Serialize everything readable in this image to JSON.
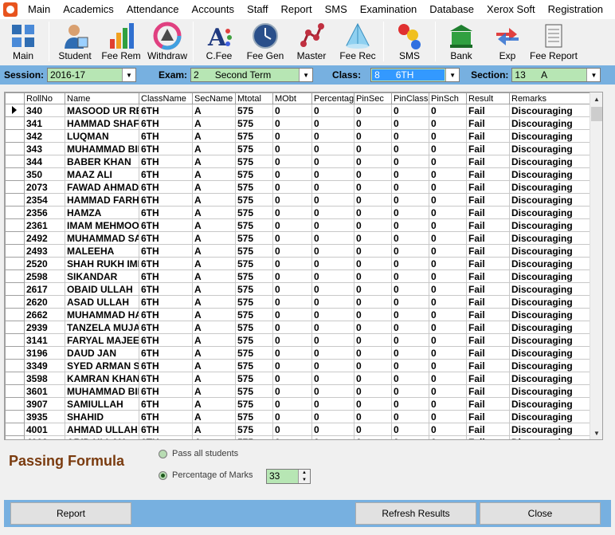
{
  "menu": [
    "Main",
    "Academics",
    "Attendance",
    "Accounts",
    "Staff",
    "Report",
    "SMS",
    "Examination",
    "Database",
    "Xerox Soft",
    "Registration"
  ],
  "toolbar": [
    {
      "label": "Main",
      "icon": "grid-icon"
    },
    {
      "label": "Student",
      "icon": "student-icon"
    },
    {
      "label": "Fee Rem",
      "icon": "bar-chart-icon"
    },
    {
      "label": "Withdraw",
      "icon": "color-wheel-icon"
    },
    {
      "label": "C.Fee",
      "icon": "font-icon"
    },
    {
      "label": "Fee Gen",
      "icon": "clock-icon"
    },
    {
      "label": "Master",
      "icon": "network-icon"
    },
    {
      "label": "Fee Rec",
      "icon": "pyramid-icon"
    },
    {
      "label": "SMS",
      "icon": "molecule-icon"
    },
    {
      "label": "Bank",
      "icon": "bank-icon"
    },
    {
      "label": "Exp",
      "icon": "arrows-icon"
    },
    {
      "label": "Fee Report",
      "icon": "scroll-icon"
    }
  ],
  "filters": {
    "session_label": "Session:",
    "session_value": "2016-17",
    "exam_label": "Exam:",
    "exam_value": "2      Second Term",
    "class_label": "Class:",
    "class_value": "8      6TH",
    "section_label": "Section:",
    "section_value": "13      A"
  },
  "columns": [
    "RollNo",
    "Name",
    "ClassName",
    "SecName",
    "Mtotal",
    "MObt",
    "Percentage",
    "PinSec",
    "PinClass",
    "PinSch",
    "Result",
    "Remarks"
  ],
  "rows": [
    [
      "340",
      "MASOOD UR REHMAN",
      "6TH",
      "A",
      "575",
      "0",
      "0",
      "0",
      "0",
      "0",
      "Fail",
      "Discouraging"
    ],
    [
      "341",
      "HAMMAD SHAFIQ",
      "6TH",
      "A",
      "575",
      "0",
      "0",
      "0",
      "0",
      "0",
      "Fail",
      "Discouraging"
    ],
    [
      "342",
      "LUQMAN",
      "6TH",
      "A",
      "575",
      "0",
      "0",
      "0",
      "0",
      "0",
      "Fail",
      "Discouraging"
    ],
    [
      "343",
      "MUHAMMAD BILAL",
      "6TH",
      "A",
      "575",
      "0",
      "0",
      "0",
      "0",
      "0",
      "Fail",
      "Discouraging"
    ],
    [
      "344",
      "BABER KHAN",
      "6TH",
      "A",
      "575",
      "0",
      "0",
      "0",
      "0",
      "0",
      "Fail",
      "Discouraging"
    ],
    [
      "350",
      "MAAZ ALI",
      "6TH",
      "A",
      "575",
      "0",
      "0",
      "0",
      "0",
      "0",
      "Fail",
      "Discouraging"
    ],
    [
      "2073",
      "FAWAD AHMAD",
      "6TH",
      "A",
      "575",
      "0",
      "0",
      "0",
      "0",
      "0",
      "Fail",
      "Discouraging"
    ],
    [
      "2354",
      "HAMMAD FARHAN",
      "6TH",
      "A",
      "575",
      "0",
      "0",
      "0",
      "0",
      "0",
      "Fail",
      "Discouraging"
    ],
    [
      "2356",
      "HAMZA",
      "6TH",
      "A",
      "575",
      "0",
      "0",
      "0",
      "0",
      "0",
      "Fail",
      "Discouraging"
    ],
    [
      "2361",
      "IMAM MEHMOOD",
      "6TH",
      "A",
      "575",
      "0",
      "0",
      "0",
      "0",
      "0",
      "Fail",
      "Discouraging"
    ],
    [
      "2492",
      "MUHAMMAD SAAD",
      "6TH",
      "A",
      "575",
      "0",
      "0",
      "0",
      "0",
      "0",
      "Fail",
      "Discouraging"
    ],
    [
      "2493",
      "MALEEHA",
      "6TH",
      "A",
      "575",
      "0",
      "0",
      "0",
      "0",
      "0",
      "Fail",
      "Discouraging"
    ],
    [
      "2520",
      "SHAH RUKH IMRAN",
      "6TH",
      "A",
      "575",
      "0",
      "0",
      "0",
      "0",
      "0",
      "Fail",
      "Discouraging"
    ],
    [
      "2598",
      "SIKANDAR",
      "6TH",
      "A",
      "575",
      "0",
      "0",
      "0",
      "0",
      "0",
      "Fail",
      "Discouraging"
    ],
    [
      "2617",
      "OBAID ULLAH",
      "6TH",
      "A",
      "575",
      "0",
      "0",
      "0",
      "0",
      "0",
      "Fail",
      "Discouraging"
    ],
    [
      "2620",
      "ASAD ULLAH",
      "6TH",
      "A",
      "575",
      "0",
      "0",
      "0",
      "0",
      "0",
      "Fail",
      "Discouraging"
    ],
    [
      "2662",
      "MUHAMMAD HAMZA",
      "6TH",
      "A",
      "575",
      "0",
      "0",
      "0",
      "0",
      "0",
      "Fail",
      "Discouraging"
    ],
    [
      "2939",
      "TANZELA MUJAHID",
      "6TH",
      "A",
      "575",
      "0",
      "0",
      "0",
      "0",
      "0",
      "Fail",
      "Discouraging"
    ],
    [
      "3141",
      "FARYAL MAJEED",
      "6TH",
      "A",
      "575",
      "0",
      "0",
      "0",
      "0",
      "0",
      "Fail",
      "Discouraging"
    ],
    [
      "3196",
      "DAUD JAN",
      "6TH",
      "A",
      "575",
      "0",
      "0",
      "0",
      "0",
      "0",
      "Fail",
      "Discouraging"
    ],
    [
      "3349",
      "SYED ARMAN SHAH",
      "6TH",
      "A",
      "575",
      "0",
      "0",
      "0",
      "0",
      "0",
      "Fail",
      "Discouraging"
    ],
    [
      "3598",
      "KAMRAN KHAN",
      "6TH",
      "A",
      "575",
      "0",
      "0",
      "0",
      "0",
      "0",
      "Fail",
      "Discouraging"
    ],
    [
      "3601",
      "MUHAMMAD BILAL",
      "6TH",
      "A",
      "575",
      "0",
      "0",
      "0",
      "0",
      "0",
      "Fail",
      "Discouraging"
    ],
    [
      "3907",
      "SAMIULLAH",
      "6TH",
      "A",
      "575",
      "0",
      "0",
      "0",
      "0",
      "0",
      "Fail",
      "Discouraging"
    ],
    [
      "3935",
      "SHAHID",
      "6TH",
      "A",
      "575",
      "0",
      "0",
      "0",
      "0",
      "0",
      "Fail",
      "Discouraging"
    ],
    [
      "4001",
      "AHMAD ULLAH",
      "6TH",
      "A",
      "575",
      "0",
      "0",
      "0",
      "0",
      "0",
      "Fail",
      "Discouraging"
    ],
    [
      "4002",
      "ABID ULLAH",
      "6TH",
      "A",
      "575",
      "0",
      "0",
      "0",
      "0",
      "0",
      "Fail",
      "Discouraging"
    ]
  ],
  "passing": {
    "title": "Passing Formula",
    "opt_all": "Pass all students",
    "opt_pct": "Percentage of Marks",
    "pct_value": "33"
  },
  "buttons": {
    "report": "Report",
    "refresh": "Refresh Results",
    "close": "Close"
  },
  "colors": {
    "panel": "#77b0e0",
    "combo": "#b7e6b4",
    "title": "#7a3b0f",
    "selection": "#3399ff"
  }
}
